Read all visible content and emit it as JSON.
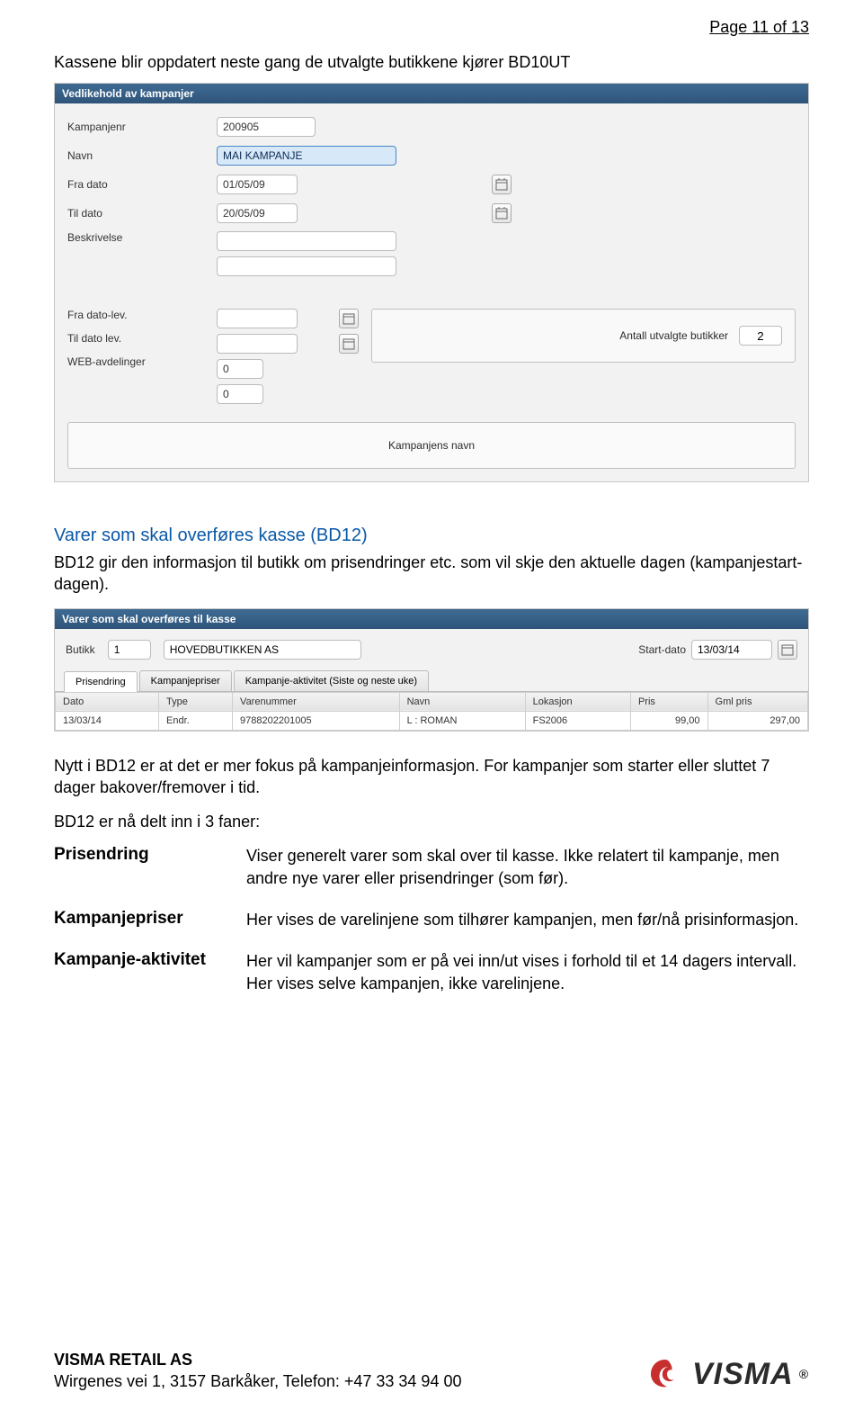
{
  "page_number": "Page 11 of 13",
  "intro": "Kassene blir oppdatert neste gang de utvalgte butikkene kjører BD10UT",
  "panel": {
    "title": "Vedlikehold av kampanjer",
    "rows": {
      "kampanjenr": {
        "label": "Kampanjenr",
        "value": "200905"
      },
      "navn": {
        "label": "Navn",
        "value": "MAI KAMPANJE"
      },
      "fradato": {
        "label": "Fra dato",
        "value": "01/05/09"
      },
      "tildato": {
        "label": "Til dato",
        "value": "20/05/09"
      },
      "beskrivelse": {
        "label": "Beskrivelse"
      },
      "fradatolev": {
        "label": "Fra dato-lev."
      },
      "tildatolev": {
        "label": "Til dato lev."
      },
      "webavd": {
        "label": "WEB-avdelinger",
        "value": "0",
        "value2": "0"
      }
    },
    "side": {
      "label": "Antall utvalgte butikker",
      "value": "2"
    },
    "wide_label": "Kampanjens navn"
  },
  "heading": "Varer som skal overføres kasse (BD12)",
  "para1": "BD12 gir den informasjon til butikk om prisendringer etc. som vil skje den aktuelle dagen (kampanjestart-dagen).",
  "panel2": {
    "title": "Varer som skal overføres til kasse",
    "butikk_label": "Butikk",
    "butikk_id": "1",
    "butikk_name": "HOVEDBUTIKKEN AS",
    "startdato_label": "Start-dato",
    "startdato": "13/03/14",
    "tabs": {
      "t1": "Prisendring",
      "t2": "Kampanjepriser",
      "t3": "Kampanje-aktivitet (Siste og neste uke)"
    },
    "cols": {
      "dato": "Dato",
      "type": "Type",
      "varenummer": "Varenummer",
      "navn": "Navn",
      "lokasjon": "Lokasjon",
      "pris": "Pris",
      "gmlpris": "Gml pris"
    },
    "row1": {
      "dato": "13/03/14",
      "type": "Endr.",
      "varenummer": "9788202201005",
      "navn": "L : ROMAN",
      "lokasjon": "FS2006",
      "pris": "99,00",
      "gmlpris": "297,00"
    }
  },
  "para2": "Nytt i BD12 er at det er mer fokus på kampanjeinformasjon. For kampanjer som starter eller sluttet 7 dager bakover/fremover i tid.",
  "para3": "BD12 er nå delt inn i 3 faner:",
  "defs": {
    "d1": {
      "term": "Prisendring",
      "desc": "Viser generelt varer som skal over til kasse. Ikke relatert til kampanje, men andre nye varer eller prisendringer (som før)."
    },
    "d2": {
      "term": "Kampanjepriser",
      "desc": "Her vises de varelinjene som tilhører kampanjen, men før/nå prisinformasjon."
    },
    "d3": {
      "term": "Kampanje-aktivitet",
      "desc": "Her vil kampanjer som er på vei inn/ut vises i forhold til et 14 dagers intervall. Her vises selve kampanjen, ikke varelinjene."
    }
  },
  "footer": {
    "company": "VISMA RETAIL AS",
    "address": "Wirgenes vei 1, 3157 Barkåker, Telefon: +47 33 34 94 00",
    "logo": "VISMA"
  }
}
